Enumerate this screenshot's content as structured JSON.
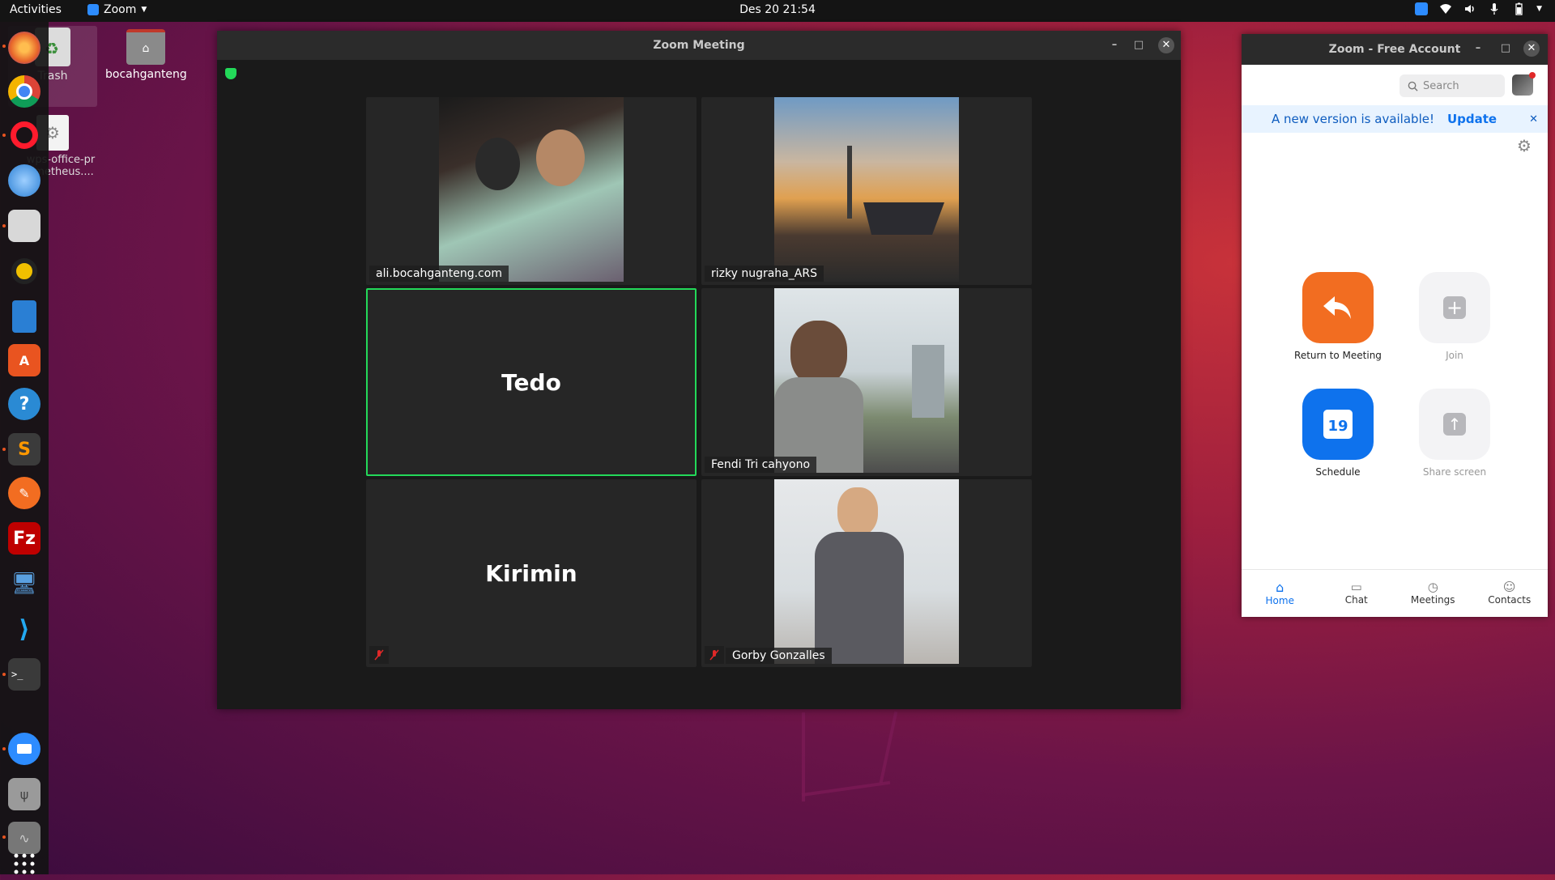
{
  "topbar": {
    "activities": "Activities",
    "app_name": "Zoom",
    "clock": "Des 20  21:54"
  },
  "desktop": {
    "icons": [
      {
        "label": "Trash"
      },
      {
        "label": "bocahganteng"
      },
      {
        "label": "wps-office-prometheus...."
      }
    ]
  },
  "dock": {
    "items": [
      "firefox",
      "chrome",
      "opera",
      "thunderbird",
      "files",
      "rhythmbox",
      "libreoffice-writer",
      "software-center",
      "help",
      "sublime-text",
      "inkscape",
      "filezilla",
      "remote-desktop",
      "vscode",
      "terminal",
      "zoom",
      "usb-drive",
      "audio-recorder",
      "show-applications"
    ]
  },
  "meeting": {
    "title": "Zoom Meeting",
    "participants": [
      {
        "name": "ali.bocahganteng.com"
      },
      {
        "name": "rizky nugraha_ARS"
      },
      {
        "name": "Tedo"
      },
      {
        "name": "Fendi Tri cahyono"
      },
      {
        "name": "Kirimin"
      },
      {
        "name": "Gorby Gonzalles"
      }
    ]
  },
  "home": {
    "title": "Zoom - Free Account",
    "search_placeholder": "Search",
    "banner_text": "A new version is available!",
    "banner_action": "Update",
    "actions": {
      "return": "Return to Meeting",
      "join": "Join",
      "schedule": "Schedule",
      "schedule_day": "19",
      "share": "Share screen"
    },
    "tabs": {
      "home": "Home",
      "chat": "Chat",
      "meetings": "Meetings",
      "contacts": "Contacts"
    }
  },
  "colors": {
    "zoom_blue": "#0e72ed",
    "return_orange": "#f26d21",
    "active_speaker": "#23d959"
  }
}
